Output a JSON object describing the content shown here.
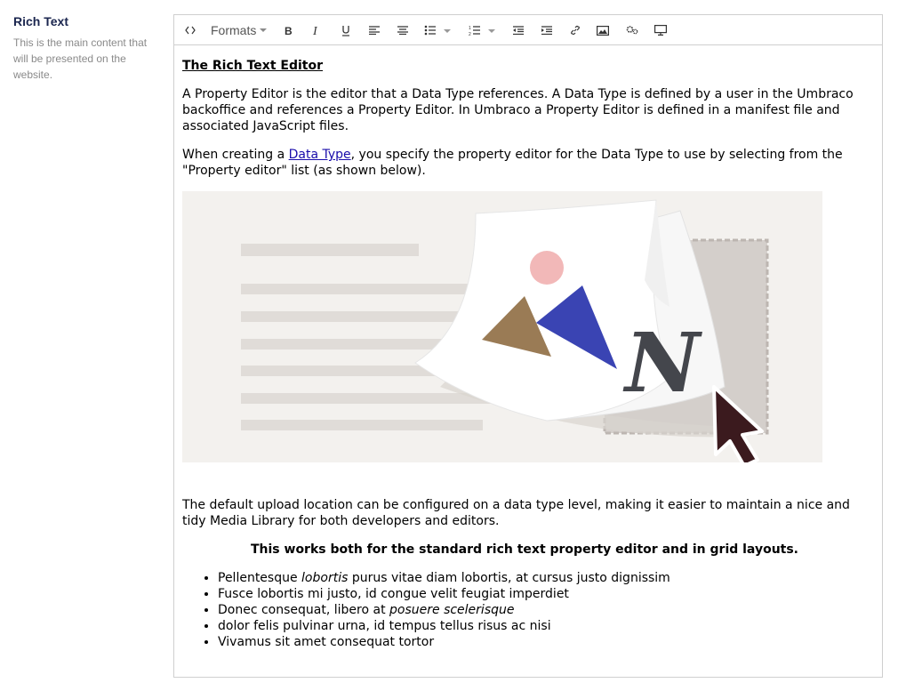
{
  "property": {
    "label": "Rich Text",
    "description": "This is the main content that will be presented on the website."
  },
  "toolbar": {
    "formats_label": "Formats",
    "buttons": [
      {
        "icon": "source-code-icon"
      },
      {
        "icon": "bold-icon"
      },
      {
        "icon": "italic-icon"
      },
      {
        "icon": "underline-icon"
      },
      {
        "icon": "align-left-icon"
      },
      {
        "icon": "align-center-icon"
      },
      {
        "icon": "bullet-list-icon"
      },
      {
        "icon": "numbered-list-icon"
      },
      {
        "icon": "outdent-icon"
      },
      {
        "icon": "indent-icon"
      },
      {
        "icon": "link-icon"
      },
      {
        "icon": "image-icon"
      },
      {
        "icon": "macro-icon"
      },
      {
        "icon": "embed-icon"
      }
    ]
  },
  "content": {
    "heading": "The Rich Text Editor",
    "para1": "A Property Editor is the editor that a Data Type references. A Data Type is defined by a user in the Umbraco backoffice and references a Property Editor. In Umbraco a Property Editor is defined in a manifest file and associated JavaScript files.",
    "para2_before": "When creating a ",
    "para2_link": "Data Type",
    "para2_after": ", you specify the property editor for the Data Type to use by selecting from the \"Property editor\" list (as shown below).",
    "para3": "The default upload location can be configured on a data type level, making it easier to maintain a nice and tidy Media Library for both developers and editors.",
    "centered_bold": "This works both for the standard rich text property editor and in grid layouts.",
    "list": [
      {
        "before": "Pellentesque ",
        "italic": "lobortis",
        "after": " purus vitae diam lobortis, at cursus justo dignissim"
      },
      {
        "before": "Fusce lobortis mi justo, id congue velit feugiat imperdiet",
        "italic": "",
        "after": ""
      },
      {
        "before": "Donec consequat, libero at ",
        "italic": "posuere scelerisque",
        "after": ""
      },
      {
        "before": "dolor felis pulvinar urna, id tempus tellus risus ac nisi",
        "italic": "",
        "after": ""
      },
      {
        "before": "Vivamus sit amet consequat tortor",
        "italic": "",
        "after": ""
      }
    ]
  },
  "colors": {
    "accent_blue": "#3a44b3",
    "mountain_brown": "#9a7b55",
    "sun_pink": "#f2b8b8",
    "cursor_dark": "#3b1a1e",
    "image_bg": "#f3f1ee"
  }
}
